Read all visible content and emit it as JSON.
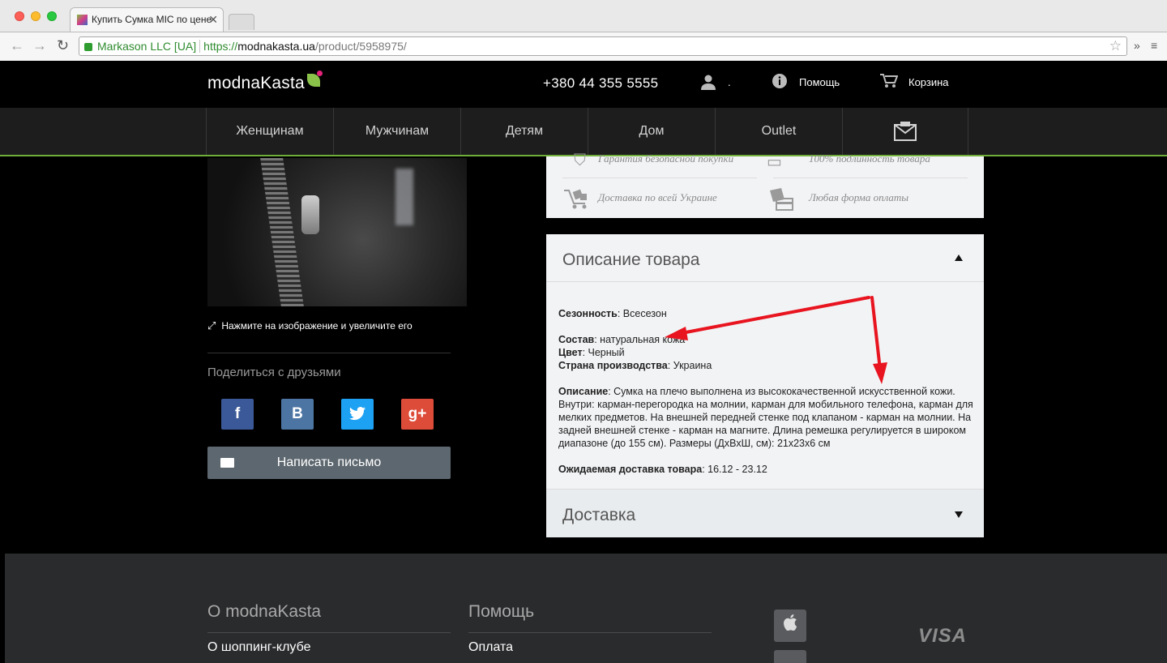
{
  "browser": {
    "tab_title": "Купить Сумка MIC по цене",
    "ev_label": "Markason LLC [UA]",
    "url_scheme": "https://",
    "url_domain": "modnakasta.ua",
    "url_path": "/product/5958975/"
  },
  "header": {
    "logo_text": "modnaKasta",
    "phone": "+380 44 355 5555",
    "account_label": ".",
    "help_label": "Помощь",
    "cart_label": "Корзина"
  },
  "nav": {
    "items": [
      "Женщинам",
      "Мужчинам",
      "Детям",
      "Дом",
      "Outlet"
    ]
  },
  "gallery": {
    "enlarge_hint": "Нажмите на изображение и увеличите его"
  },
  "share": {
    "title": "Поделиться с друзьями",
    "facebook": "f",
    "vk": "B",
    "twitter": "t",
    "gplus": "g+",
    "mail_button": "Написать письмо"
  },
  "benefits": {
    "secure": "Гарантия безопасной покупки",
    "original": "100% подлинность товара",
    "delivery": "Доставка по всей Украине",
    "payment": "Любая форма оплаты"
  },
  "description": {
    "title": "Описание товара",
    "season_label": "Сезонность",
    "season_value": ": Всесезон",
    "material_label": "Состав",
    "material_value": ": натуральная кожа",
    "color_label": "Цвет",
    "color_value": ": Черный",
    "country_label": "Страна производства",
    "country_value": ": Украина",
    "desc_label": "Описание",
    "desc_value": ": Сумка на плечо выполнена из высококачественной искусственной кожи. Внутри: карман-перегородка на молнии, карман для мобильного телефона, карман для мелких предметов. На внешней передней стенке под клапаном - карман на молнии. На задней внешней стенке - карман на магните. Длина ремешка регулируется в широком диапазоне (до 155 см). Размеры (ДхВхШ, см): 21х23х6 см",
    "delivery_label": "Ожидаемая доставка товара",
    "delivery_value": ": 16.12 - 23.12"
  },
  "delivery_section": {
    "title": "Доставка"
  },
  "footer": {
    "col1_title": "О modnaKasta",
    "col1_link": "О шоппинг-клубе",
    "col2_title": "Помощь",
    "col2_link": "Оплата",
    "visa": "VISA"
  },
  "colors": {
    "accent_green": "#6fae3a",
    "facebook": "#3b5998",
    "vk": "#4c75a3",
    "twitter": "#1da1f2",
    "gplus": "#dd4b39",
    "annotation_red": "#e8141f"
  }
}
